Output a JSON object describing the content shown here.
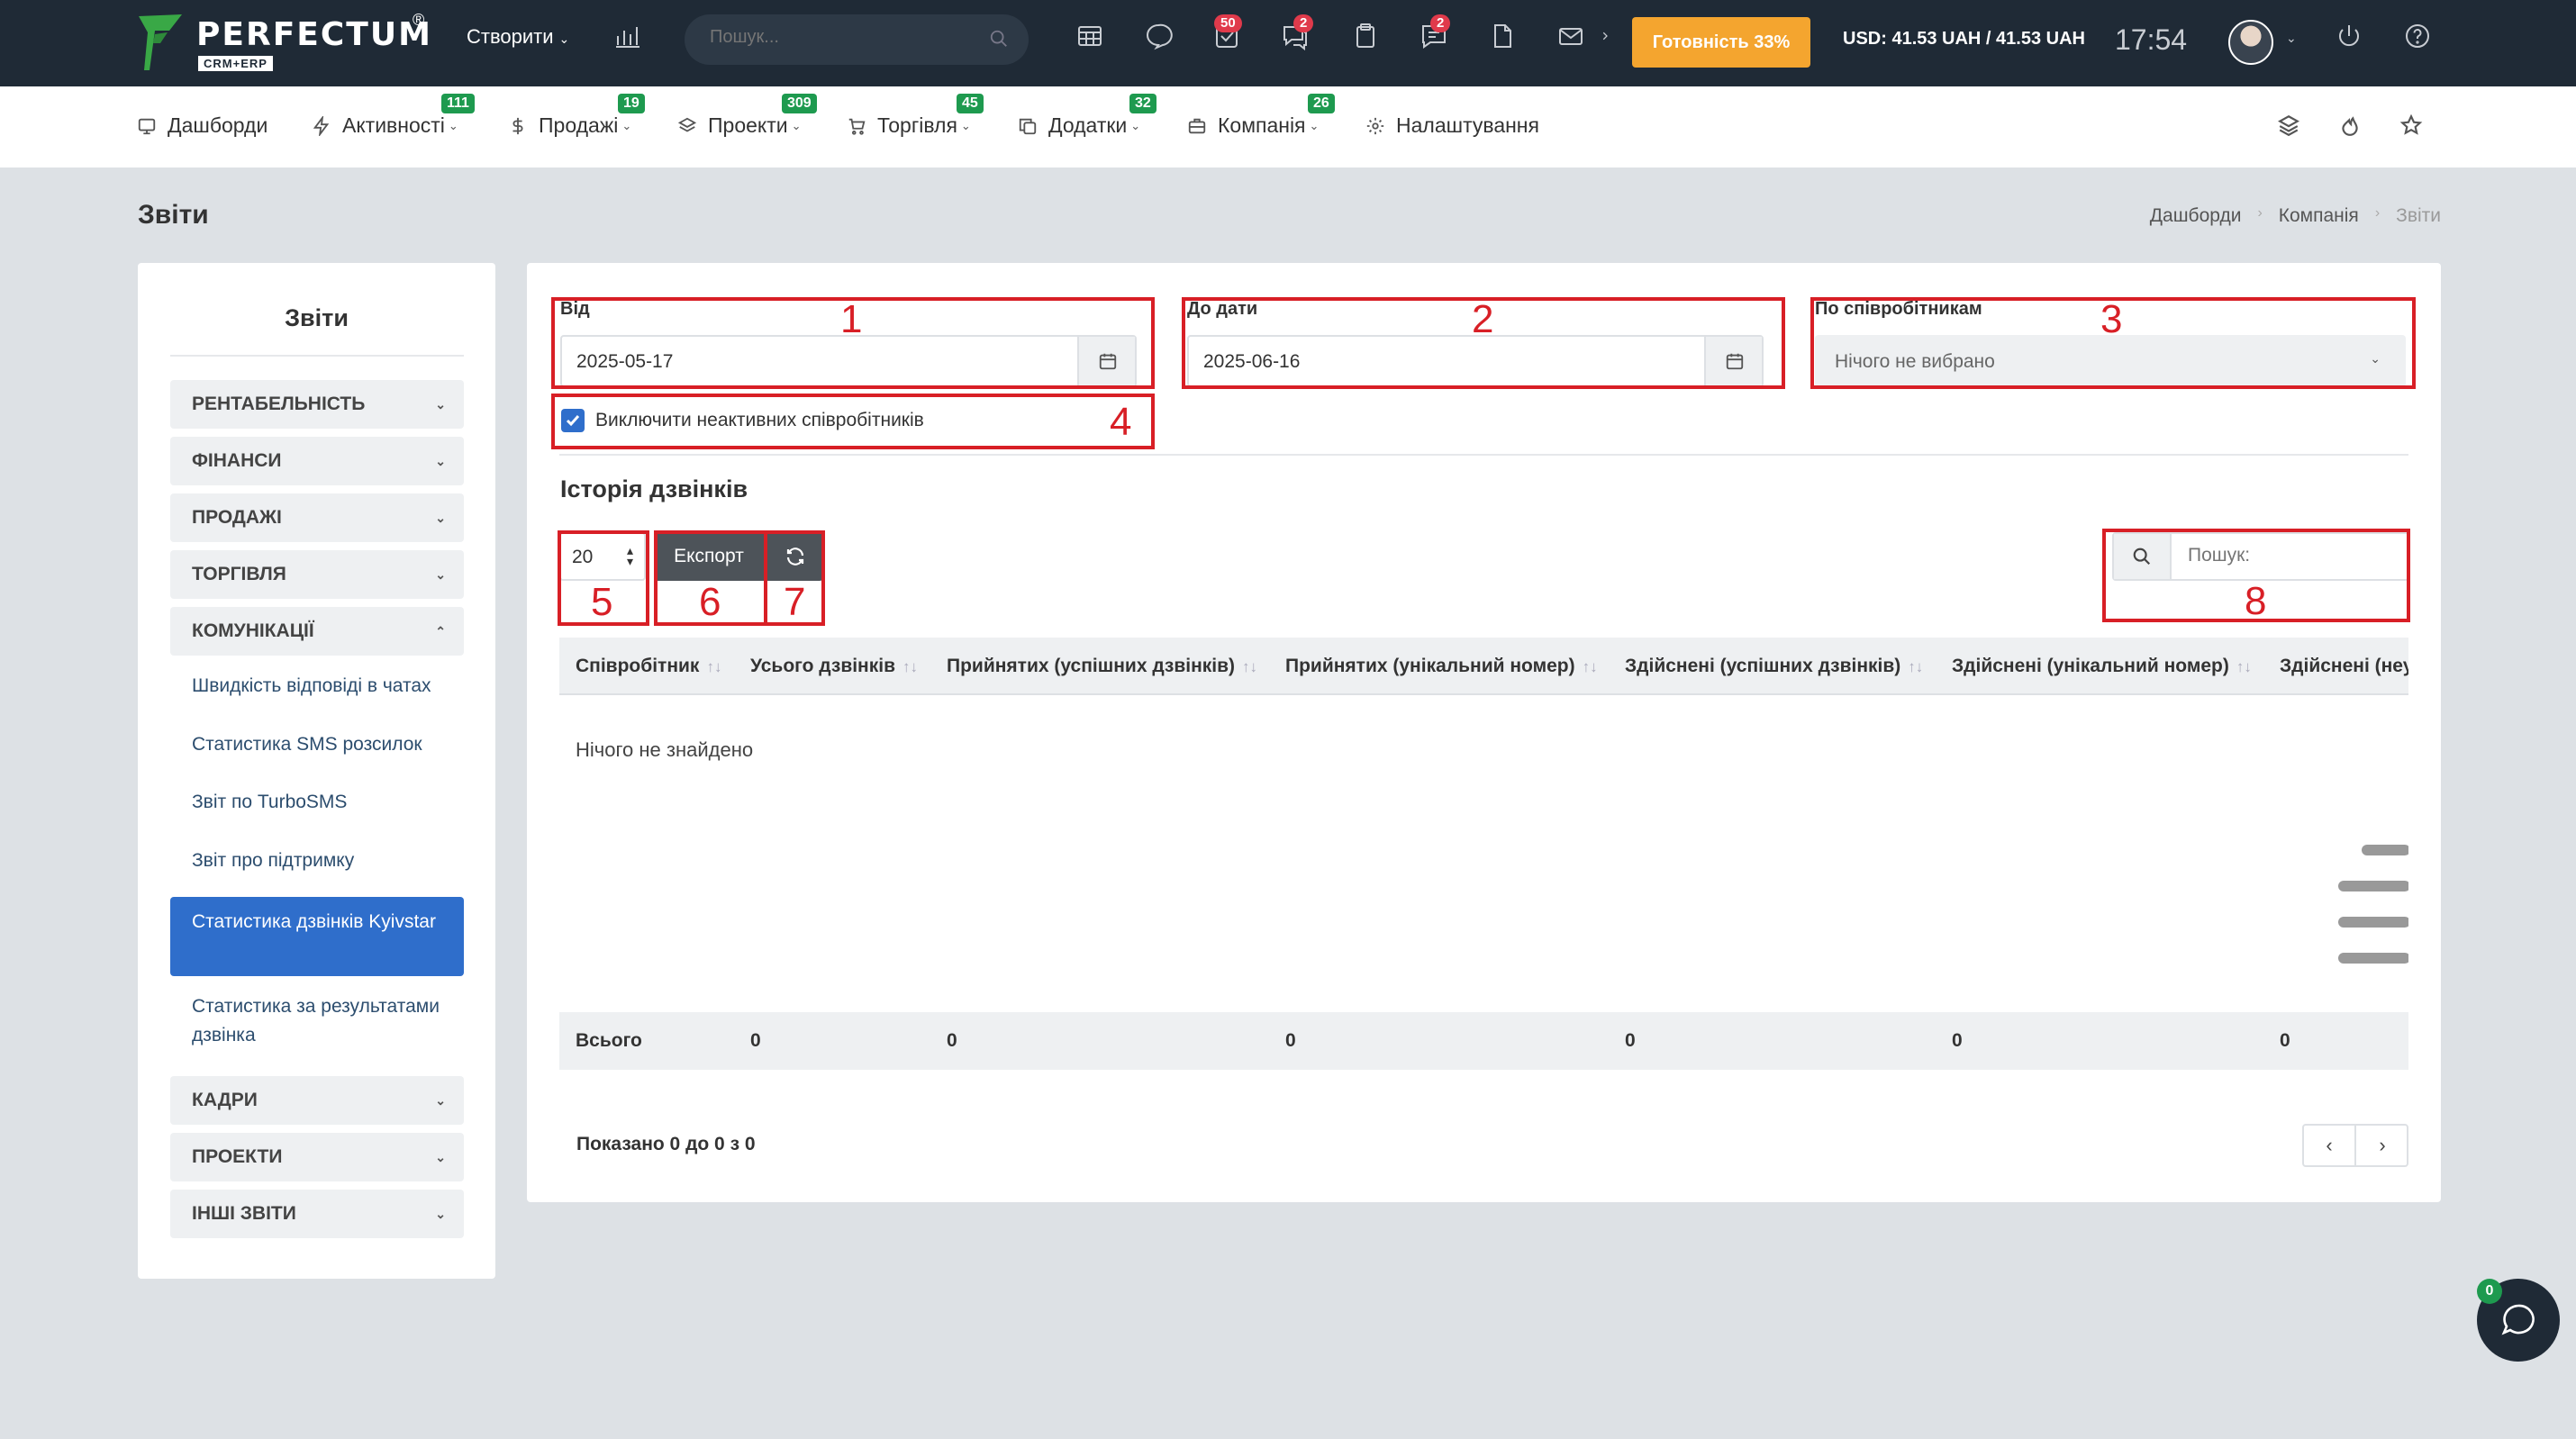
{
  "header": {
    "brand": "PERFECTUM",
    "brand_reg": "®",
    "brand_sub": "CRM+ERP",
    "create_label": "Створити",
    "search_placeholder": "Пошук...",
    "badges": {
      "tasks": "50",
      "chat": "2",
      "messages": "2"
    },
    "ready_label": "Готовність 33%",
    "currency": "USD: 41.53 UAH / 41.53 UAH",
    "time": "17:54",
    "accent_color": "#f4a52f"
  },
  "nav": {
    "items": [
      {
        "label": "Дашборди",
        "icon": "monitor-icon",
        "badge": ""
      },
      {
        "label": "Активності",
        "icon": "bolt-icon",
        "badge": "111"
      },
      {
        "label": "Продажі",
        "icon": "dollar-icon",
        "badge": "19"
      },
      {
        "label": "Проекти",
        "icon": "layers-icon",
        "badge": "309"
      },
      {
        "label": "Торгівля",
        "icon": "cart-icon",
        "badge": "45"
      },
      {
        "label": "Додатки",
        "icon": "copy-icon",
        "badge": "32"
      },
      {
        "label": "Компанія",
        "icon": "briefcase-icon",
        "badge": "26"
      },
      {
        "label": "Налаштування",
        "icon": "gear-icon",
        "badge": ""
      }
    ]
  },
  "page": {
    "title": "Звіти",
    "breadcrumb": [
      "Дашборди",
      "Компанія",
      "Звіти"
    ]
  },
  "sidebar": {
    "title": "Звіти",
    "categories": [
      "РЕНТАБЕЛЬНІСТЬ",
      "ФІНАНСИ",
      "ПРОДАЖІ",
      "ТОРГІВЛЯ",
      "КОМУНІКАЦІЇ",
      "КАДРИ",
      "ПРОЕКТИ",
      "ІНШІ ЗВІТИ"
    ],
    "links": [
      "Швидкість відповіді в чатах",
      "Статистика SMS розсилок",
      "Звіт по TurboSMS",
      "Звіт про підтримку",
      "Статистика дзвінків Kyivstar",
      "Статистика за результатами дзвінка"
    ],
    "active_color": "#2f6ecb"
  },
  "filters": {
    "from_label": "Від",
    "from_value": "2025-05-17",
    "to_label": "До дати",
    "to_value": "2025-06-16",
    "employee_label": "По співробітникам",
    "employee_value": "Нічого не вибрано",
    "exclude_inactive_label": "Виключити неактивних співробітників",
    "exclude_inactive_checked": true
  },
  "section": {
    "title": "Історія дзвінків",
    "page_size": "20",
    "export_label": "Експорт",
    "search_placeholder": "Пошук:"
  },
  "table": {
    "columns": [
      "Співробітник",
      "Усього дзвінків",
      "Прийнятих (успішних дзвінків)",
      "Прийнятих (унікальний номер)",
      "Здійснені (успішних дзвінків)",
      "Здійснені (унікальний номер)",
      "Здійснені (неу"
    ],
    "empty_text": "Нічого не знайдено",
    "footer": [
      "Всього",
      "0",
      "0",
      "0",
      "0",
      "0",
      "0"
    ],
    "showing": "Показано 0 до 0 з 0"
  },
  "annotations": [
    "1",
    "2",
    "3",
    "4",
    "5",
    "6",
    "7",
    "8"
  ],
  "chat_badge": "0"
}
